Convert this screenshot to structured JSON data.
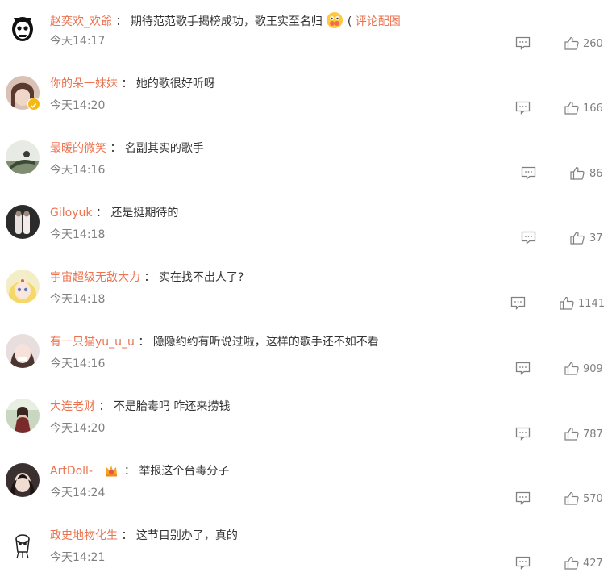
{
  "comments": [
    {
      "username": "赵奕欢_欢爺",
      "separator": "：",
      "text": "期待范范歌手揭榜成功，歌王实至名归",
      "emoji": "smile-emoji",
      "extra_prefix": "(",
      "link": "评论配图",
      "time": "今天14:17",
      "likes": "260"
    },
    {
      "username": "你的朵一妹妹",
      "separator": "：",
      "text": "她的歌很好听呀",
      "time": "今天14:20",
      "likes": "166"
    },
    {
      "username": "最暖的微笑",
      "separator": "：",
      "text": "名副其实的歌手",
      "time": "今天14:16",
      "likes": "86"
    },
    {
      "username": "Giloyuk",
      "separator": "：",
      "text": "还是挺期待的",
      "time": "今天14:18",
      "likes": "37"
    },
    {
      "username": "宇宙超级无敌大力",
      "separator": "：",
      "text": "实在找不出人了?",
      "time": "今天14:18",
      "likes": "1141"
    },
    {
      "username": "有一只猫yu_u_u",
      "separator": "：",
      "text": "隐隐约约有听说过啦，这样的歌手还不如不看",
      "time": "今天14:16",
      "likes": "909"
    },
    {
      "username": "大连老财",
      "separator": "：",
      "text": "不是胎毒吗 咋还来捞钱",
      "time": "今天14:20",
      "likes": "787"
    },
    {
      "username": "ArtDoll-",
      "separator": "：",
      "text": "举报这个台毒分子",
      "badge": "crown-badge-icon",
      "time": "今天14:24",
      "likes": "570"
    },
    {
      "username": "政史地物化生",
      "separator": "：",
      "text": "这节目别办了，真的",
      "time": "今天14:21",
      "likes": "427"
    }
  ],
  "colors": {
    "username": "#eb7350",
    "text": "#333333",
    "meta": "#808080"
  }
}
